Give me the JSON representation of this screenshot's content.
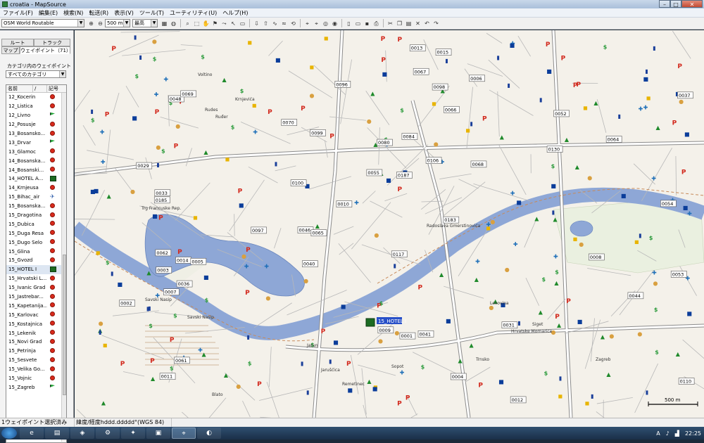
{
  "window": {
    "title": "croatia - MapSource",
    "minimize": "–",
    "maximize": "□",
    "close": "✕"
  },
  "menu": [
    "ファイル(F)",
    "編集(E)",
    "検索(N)",
    "転送(R)",
    "表示(V)",
    "ツール(T)",
    "ユーティリティ(U)",
    "ヘルプ(H)"
  ],
  "toolbar": {
    "map_product": "OSM World Routable",
    "scale": "500 m",
    "detail": "最高"
  },
  "left_pane": {
    "tab_route": "ルート",
    "tab_track": "トラック",
    "tab_map": "マップ",
    "tab_waypoint": "ウェイポイント（71）",
    "category_label": "カテゴリ内のウェイポイントの表",
    "category_value": "すべてのカテゴリ",
    "col_name": "名前",
    "col_sort": "/",
    "col_symbol": "記号",
    "waypoints": [
      {
        "name": "12_Kocerin",
        "symbol": "pin"
      },
      {
        "name": "12_Listica",
        "symbol": "pin"
      },
      {
        "name": "12_Livno",
        "symbol": "flag"
      },
      {
        "name": "12_Posusje",
        "symbol": "pin"
      },
      {
        "name": "13_Bosansko...",
        "symbol": "pin"
      },
      {
        "name": "13_Drvar",
        "symbol": "flag"
      },
      {
        "name": "13_Glamoc",
        "symbol": "pin"
      },
      {
        "name": "14_Bosanska...",
        "symbol": "pin"
      },
      {
        "name": "14_Bosanski...",
        "symbol": "pin"
      },
      {
        "name": "14_HOTEL A...",
        "symbol": "hotel"
      },
      {
        "name": "14_Krnjeusa",
        "symbol": "pin"
      },
      {
        "name": "15_Bihac_air",
        "symbol": "plane"
      },
      {
        "name": "15_Bosanska...",
        "symbol": "pin"
      },
      {
        "name": "15_Dragotina",
        "symbol": "pin"
      },
      {
        "name": "15_Dubica",
        "symbol": "pin"
      },
      {
        "name": "15_Duga Resa",
        "symbol": "pin"
      },
      {
        "name": "15_Dugo Selo",
        "symbol": "pin"
      },
      {
        "name": "15_Glina",
        "symbol": "pin"
      },
      {
        "name": "15_Gvozd",
        "symbol": "pin"
      },
      {
        "name": "15_HOTEL I",
        "symbol": "hotel"
      },
      {
        "name": "15_Hrvatski L...",
        "symbol": "pin"
      },
      {
        "name": "15_Ivanic Grad",
        "symbol": "pin"
      },
      {
        "name": "15_Jastrebar...",
        "symbol": "pin"
      },
      {
        "name": "15_Kapetanija...",
        "symbol": "pin"
      },
      {
        "name": "15_Karlovac",
        "symbol": "pin"
      },
      {
        "name": "15_Kostajnica",
        "symbol": "pin"
      },
      {
        "name": "15_Lekenik",
        "symbol": "pin"
      },
      {
        "name": "15_Novi Grad",
        "symbol": "pin"
      },
      {
        "name": "15_Petrinja",
        "symbol": "pin"
      },
      {
        "name": "15_Sesvete",
        "symbol": "pin"
      },
      {
        "name": "15_Velika Go...",
        "symbol": "pin"
      },
      {
        "name": "15_Vojnic",
        "symbol": "pin"
      },
      {
        "name": "15_Zagreb",
        "symbol": "flag"
      }
    ]
  },
  "map": {
    "street_labels": [
      "Voltino",
      "Krnjevića",
      "Trg Francuske Rep.",
      "Ruđer",
      "Rudes",
      "Savski Nasip",
      "Jarun",
      "Radoslava Gmerstinovića",
      "Siget",
      "Lexovina",
      "Hrvatske Mornarice",
      "Trnsko",
      "Sopot",
      "Jarušćica",
      "Remetinec",
      "Blato",
      "Savski Nasip",
      "Zagreb"
    ],
    "road_refs": [
      "0040",
      "0029",
      "0036",
      "0046",
      "0041",
      "0048",
      "0033",
      "0044",
      "0052",
      "0053",
      "0055",
      "0096",
      "0097",
      "0098",
      "0099",
      "0100",
      "0106",
      "0110",
      "0117",
      "0130",
      "0183",
      "0185",
      "0187",
      "0084",
      "0080",
      "0061",
      "0062",
      "0054",
      "0037",
      "0031",
      "0064",
      "0065",
      "0066",
      "0067",
      "0068",
      "0069",
      "0070",
      "0011",
      "0012",
      "0013",
      "0014",
      "0015",
      "0001",
      "0002",
      "0003",
      "0004",
      "0005",
      "0006",
      "0007",
      "0008",
      "0009",
      "0010"
    ],
    "hotel_label": "15_HOTEL I",
    "scale_label": "500 m",
    "colors": {
      "river": "#8ea7d6",
      "lake": "#8ea7d6",
      "land": "#f4f1ea",
      "road": "#ffffff",
      "road_outline": "#9a9a9a",
      "major_road": "#ffffff"
    }
  },
  "status": {
    "selected": "1ウェイポイント選択済み",
    "coords": "緯度/経度hddd.ddddd°(WGS 84)"
  },
  "taskbar": {
    "start": "⊞",
    "time": "22:25",
    "lang": "A"
  }
}
